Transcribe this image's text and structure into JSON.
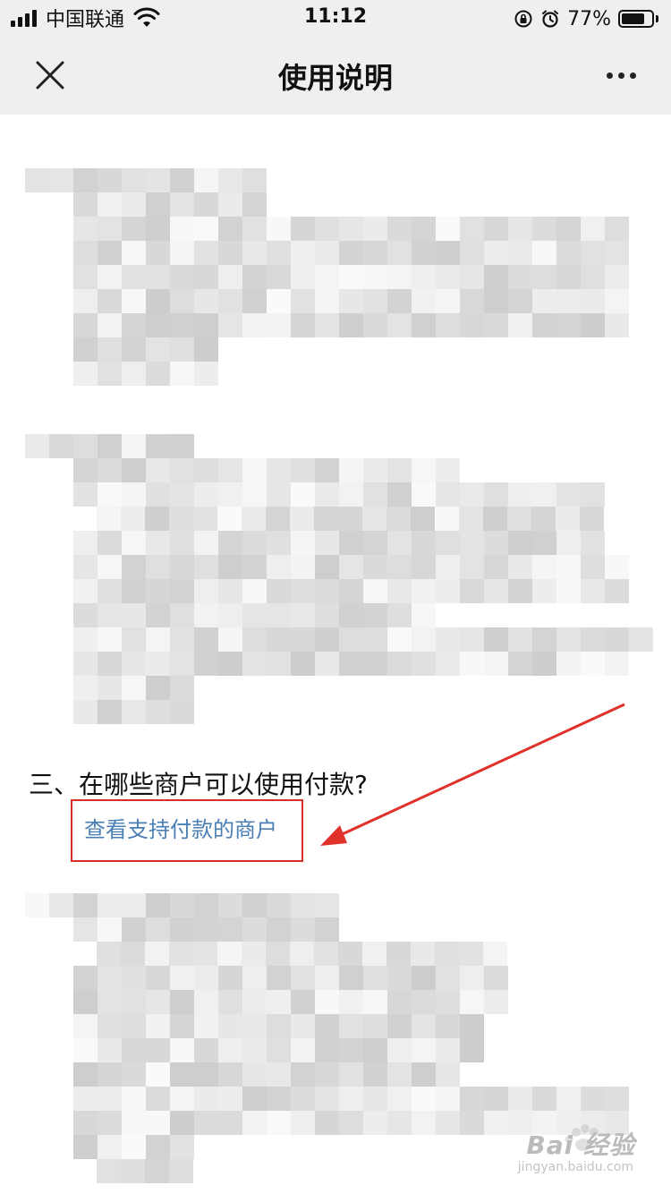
{
  "status_bar": {
    "carrier": "中国联通",
    "time": "11:12",
    "battery_percent": "77%",
    "battery_level": 0.77,
    "icons": [
      "signal-icon",
      "wifi-icon",
      "orientation-lock-icon",
      "alarm-icon",
      "battery-icon"
    ]
  },
  "nav": {
    "title": "使用说明",
    "close_icon": "close-icon",
    "more_icon": "more-icon"
  },
  "content": {
    "section3_heading": "三、在哪些商户可以使用付款?",
    "merchant_link": "查看支持付款的商户"
  },
  "annotation": {
    "box_color": "#d6302a",
    "arrow_color": "#e0312a"
  },
  "watermark": {
    "brand": "Bai 经验",
    "url": "jingyan.baidu.com"
  }
}
